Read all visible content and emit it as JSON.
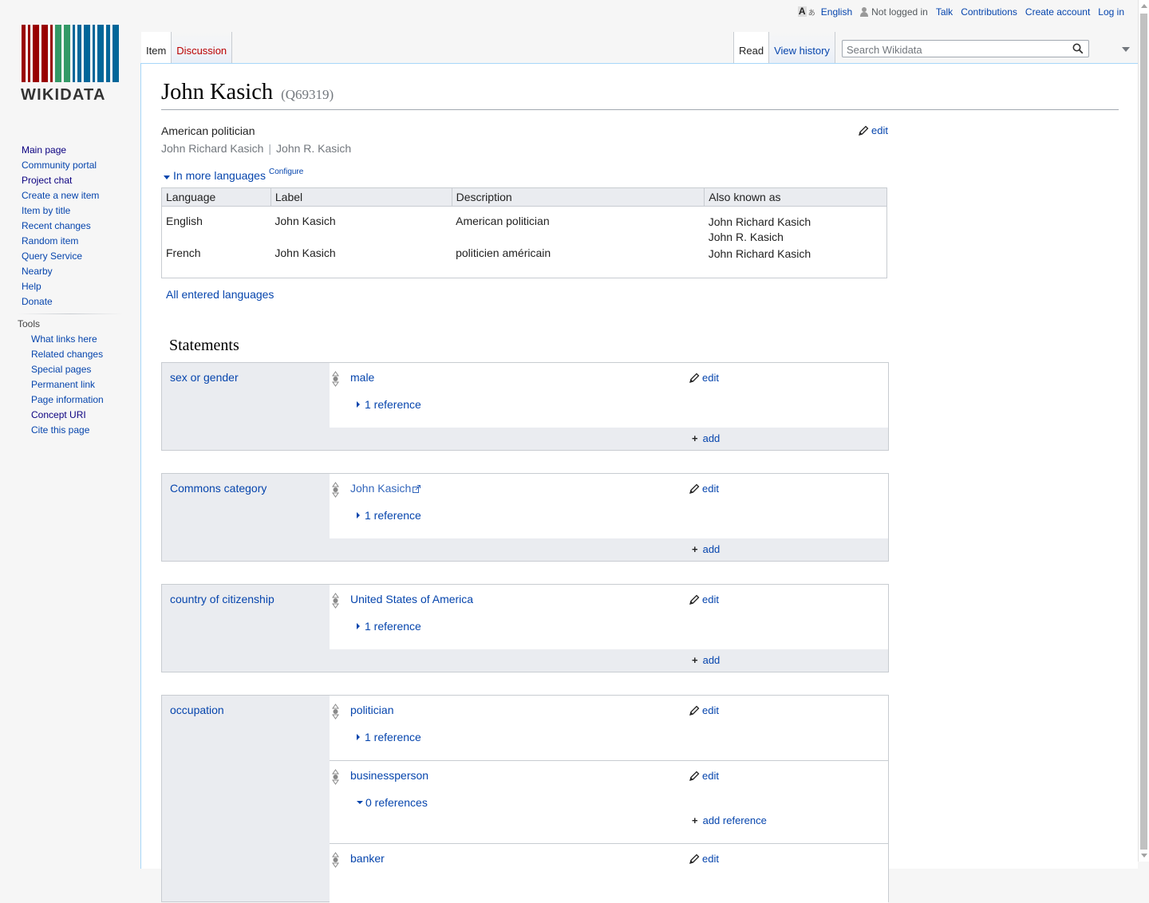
{
  "personal": {
    "language": "English",
    "not_logged_in": "Not logged in",
    "talk": "Talk",
    "contributions": "Contributions",
    "create_account": "Create account",
    "log_in": "Log in"
  },
  "logo": {
    "text": "WIKIDATA"
  },
  "sidebar": {
    "nav": [
      "Main page",
      "Community portal",
      "Project chat",
      "Create a new item",
      "Item by title",
      "Recent changes",
      "Random item",
      "Query Service",
      "Nearby",
      "Help",
      "Donate"
    ],
    "tools_heading": "Tools",
    "tools": [
      "What links here",
      "Related changes",
      "Special pages",
      "Permanent link",
      "Page information",
      "Concept URI",
      "Cite this page"
    ]
  },
  "tabs": {
    "item": "Item",
    "discussion": "Discussion",
    "read": "Read",
    "view_history": "View history"
  },
  "search": {
    "placeholder": "Search Wikidata"
  },
  "item": {
    "label": "John Kasich",
    "qid": "(Q69319)",
    "description": "American politician",
    "aliases": [
      "John Richard Kasich",
      "John R. Kasich"
    ],
    "edit": "edit"
  },
  "languages": {
    "toggle": "In more languages",
    "configure": "Configure",
    "headers": [
      "Language",
      "Label",
      "Description",
      "Also known as"
    ],
    "rows": [
      {
        "language": "English",
        "label": "John Kasich",
        "description": "American politician",
        "aliases": [
          "John Richard Kasich",
          "John R. Kasich"
        ]
      },
      {
        "language": "French",
        "label": "John Kasich",
        "description": "politicien américain",
        "aliases": [
          "John Richard Kasich"
        ]
      }
    ],
    "all_link": "All entered languages"
  },
  "statements": {
    "heading": "Statements",
    "edit": "edit",
    "add": "add",
    "add_reference": "add reference",
    "groups": [
      {
        "property": "sex or gender",
        "values": [
          {
            "value": "male",
            "refs": "1 reference"
          }
        ]
      },
      {
        "property": "Commons category",
        "values": [
          {
            "value": "John Kasich",
            "refs": "1 reference"
          }
        ]
      },
      {
        "property": "country of citizenship",
        "values": [
          {
            "value": "United States of America",
            "refs": "1 reference"
          }
        ]
      },
      {
        "property": "occupation",
        "values": [
          {
            "value": "politician",
            "refs": "1 reference"
          },
          {
            "value": "businessperson",
            "refs": "0 references"
          },
          {
            "value": "banker",
            "refs": ""
          }
        ]
      }
    ]
  },
  "colors": {
    "link": "#0645ad",
    "visited": "#0b0080",
    "new_link": "#ba0000",
    "logo_red": "#990000",
    "logo_green": "#339966",
    "logo_blue": "#006699"
  }
}
